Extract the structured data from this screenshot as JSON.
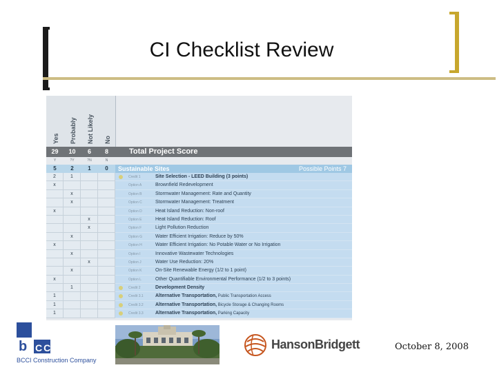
{
  "slide": {
    "title": "CI Checklist Review",
    "date": "October 8, 2008"
  },
  "checklist": {
    "column_headers": [
      "Yes",
      "Probably",
      "Not Likely",
      "No"
    ],
    "total_scores": [
      "29",
      "10",
      "6",
      "8"
    ],
    "total_title": "Total Project Score",
    "column_symbols": [
      "Y",
      "?Y",
      "?N",
      "N"
    ],
    "section": {
      "scores": [
        "5",
        "2",
        "1",
        "0"
      ],
      "title": "Sustainable Sites",
      "possible_points": "Possible Points 7"
    },
    "rows": [
      {
        "marks": [
          "2",
          "1",
          "",
          ""
        ],
        "dot": true,
        "code": "Credit 1",
        "label": "Site Selection - LEED Building (3 points)",
        "bold": true,
        "sub": ""
      },
      {
        "marks": [
          "x",
          "",
          "",
          ""
        ],
        "dot": false,
        "code": "Option A",
        "label": "Brownfield Redevelopment",
        "bold": false,
        "sub": ""
      },
      {
        "marks": [
          "",
          "x",
          "",
          ""
        ],
        "dot": false,
        "code": "Option B",
        "label": "Stormwater Management: Rate and Quantity",
        "bold": false,
        "sub": ""
      },
      {
        "marks": [
          "",
          "x",
          "",
          ""
        ],
        "dot": false,
        "code": "Option C",
        "label": "Stormwater Management: Treatment",
        "bold": false,
        "sub": ""
      },
      {
        "marks": [
          "x",
          "",
          "",
          ""
        ],
        "dot": false,
        "code": "Option D",
        "label": "Heat Island Reduction: Non-roof",
        "bold": false,
        "sub": ""
      },
      {
        "marks": [
          "",
          "",
          "x",
          ""
        ],
        "dot": false,
        "code": "Option E",
        "label": "Heat Island Reduction: Roof",
        "bold": false,
        "sub": ""
      },
      {
        "marks": [
          "",
          "",
          "x",
          ""
        ],
        "dot": false,
        "code": "Option F",
        "label": "Light Pollution Reduction",
        "bold": false,
        "sub": ""
      },
      {
        "marks": [
          "",
          "x",
          "",
          ""
        ],
        "dot": false,
        "code": "Option G",
        "label": "Water Efficient Irrigation: Reduce by 50%",
        "bold": false,
        "sub": ""
      },
      {
        "marks": [
          "x",
          "",
          "",
          ""
        ],
        "dot": false,
        "code": "Option H",
        "label": "Water Efficient Irrigation: No Potable Water or No Irrigation",
        "bold": false,
        "sub": ""
      },
      {
        "marks": [
          "",
          "x",
          "",
          ""
        ],
        "dot": false,
        "code": "Option I",
        "label": "Innovative Wastewater Technologies",
        "bold": false,
        "sub": ""
      },
      {
        "marks": [
          "",
          "",
          "x",
          ""
        ],
        "dot": false,
        "code": "Option J",
        "label": "Water Use Reduction: 20%",
        "bold": false,
        "sub": ""
      },
      {
        "marks": [
          "",
          "x",
          "",
          ""
        ],
        "dot": false,
        "code": "Option K",
        "label": "On-Site Renewable Energy (1/2 to 1 point)",
        "bold": false,
        "sub": ""
      },
      {
        "marks": [
          "x",
          "",
          "",
          ""
        ],
        "dot": false,
        "code": "Option L",
        "label": "Other Quantifiable Environmental Performance (1/2 to 3 points)",
        "bold": false,
        "sub": ""
      },
      {
        "marks": [
          "",
          "1",
          "",
          ""
        ],
        "dot": true,
        "code": "Credit 2",
        "label": "Development Density",
        "bold": true,
        "sub": ""
      },
      {
        "marks": [
          "1",
          "",
          "",
          ""
        ],
        "dot": true,
        "code": "Credit 3.1",
        "label": "Alternative Transportation,",
        "bold": true,
        "sub": " Public Transportation Access"
      },
      {
        "marks": [
          "1",
          "",
          "",
          ""
        ],
        "dot": true,
        "code": "Credit 3.2",
        "label": "Alternative Transportation,",
        "bold": true,
        "sub": " Bicycle Storage & Changing Rooms"
      },
      {
        "marks": [
          "1",
          "",
          "",
          ""
        ],
        "dot": true,
        "code": "Credit 3.3",
        "label": "Alternative Transportation,",
        "bold": true,
        "sub": " Parking Capacity"
      }
    ]
  },
  "footer": {
    "bcci_mark": "b",
    "bcci_letters": "CCI",
    "bcci_company": "BCCI Construction Company",
    "hanson_logo_text": "HansonBridgett"
  },
  "colors": {
    "title_bracket_dark": "#1b1b1b",
    "title_bracket_gold": "#c7a72e",
    "score_bar": "#6f7377",
    "section_bar": "#9fc8e4",
    "row_fill": "#c4dcf0",
    "bcci_blue": "#2c4f9c"
  }
}
